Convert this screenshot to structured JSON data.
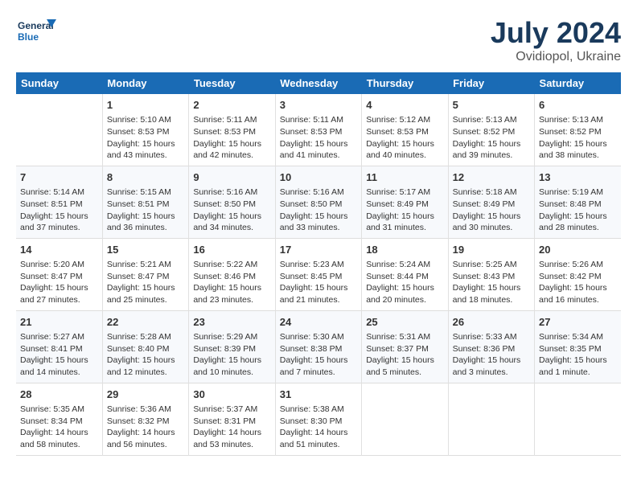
{
  "logo": {
    "line1": "General",
    "line2": "Blue"
  },
  "title": "July 2024",
  "subtitle": "Ovidiopol, Ukraine",
  "headers": [
    "Sunday",
    "Monday",
    "Tuesday",
    "Wednesday",
    "Thursday",
    "Friday",
    "Saturday"
  ],
  "weeks": [
    [
      {
        "day": "",
        "info": ""
      },
      {
        "day": "1",
        "info": "Sunrise: 5:10 AM\nSunset: 8:53 PM\nDaylight: 15 hours\nand 43 minutes."
      },
      {
        "day": "2",
        "info": "Sunrise: 5:11 AM\nSunset: 8:53 PM\nDaylight: 15 hours\nand 42 minutes."
      },
      {
        "day": "3",
        "info": "Sunrise: 5:11 AM\nSunset: 8:53 PM\nDaylight: 15 hours\nand 41 minutes."
      },
      {
        "day": "4",
        "info": "Sunrise: 5:12 AM\nSunset: 8:53 PM\nDaylight: 15 hours\nand 40 minutes."
      },
      {
        "day": "5",
        "info": "Sunrise: 5:13 AM\nSunset: 8:52 PM\nDaylight: 15 hours\nand 39 minutes."
      },
      {
        "day": "6",
        "info": "Sunrise: 5:13 AM\nSunset: 8:52 PM\nDaylight: 15 hours\nand 38 minutes."
      }
    ],
    [
      {
        "day": "7",
        "info": "Sunrise: 5:14 AM\nSunset: 8:51 PM\nDaylight: 15 hours\nand 37 minutes."
      },
      {
        "day": "8",
        "info": "Sunrise: 5:15 AM\nSunset: 8:51 PM\nDaylight: 15 hours\nand 36 minutes."
      },
      {
        "day": "9",
        "info": "Sunrise: 5:16 AM\nSunset: 8:50 PM\nDaylight: 15 hours\nand 34 minutes."
      },
      {
        "day": "10",
        "info": "Sunrise: 5:16 AM\nSunset: 8:50 PM\nDaylight: 15 hours\nand 33 minutes."
      },
      {
        "day": "11",
        "info": "Sunrise: 5:17 AM\nSunset: 8:49 PM\nDaylight: 15 hours\nand 31 minutes."
      },
      {
        "day": "12",
        "info": "Sunrise: 5:18 AM\nSunset: 8:49 PM\nDaylight: 15 hours\nand 30 minutes."
      },
      {
        "day": "13",
        "info": "Sunrise: 5:19 AM\nSunset: 8:48 PM\nDaylight: 15 hours\nand 28 minutes."
      }
    ],
    [
      {
        "day": "14",
        "info": "Sunrise: 5:20 AM\nSunset: 8:47 PM\nDaylight: 15 hours\nand 27 minutes."
      },
      {
        "day": "15",
        "info": "Sunrise: 5:21 AM\nSunset: 8:47 PM\nDaylight: 15 hours\nand 25 minutes."
      },
      {
        "day": "16",
        "info": "Sunrise: 5:22 AM\nSunset: 8:46 PM\nDaylight: 15 hours\nand 23 minutes."
      },
      {
        "day": "17",
        "info": "Sunrise: 5:23 AM\nSunset: 8:45 PM\nDaylight: 15 hours\nand 21 minutes."
      },
      {
        "day": "18",
        "info": "Sunrise: 5:24 AM\nSunset: 8:44 PM\nDaylight: 15 hours\nand 20 minutes."
      },
      {
        "day": "19",
        "info": "Sunrise: 5:25 AM\nSunset: 8:43 PM\nDaylight: 15 hours\nand 18 minutes."
      },
      {
        "day": "20",
        "info": "Sunrise: 5:26 AM\nSunset: 8:42 PM\nDaylight: 15 hours\nand 16 minutes."
      }
    ],
    [
      {
        "day": "21",
        "info": "Sunrise: 5:27 AM\nSunset: 8:41 PM\nDaylight: 15 hours\nand 14 minutes."
      },
      {
        "day": "22",
        "info": "Sunrise: 5:28 AM\nSunset: 8:40 PM\nDaylight: 15 hours\nand 12 minutes."
      },
      {
        "day": "23",
        "info": "Sunrise: 5:29 AM\nSunset: 8:39 PM\nDaylight: 15 hours\nand 10 minutes."
      },
      {
        "day": "24",
        "info": "Sunrise: 5:30 AM\nSunset: 8:38 PM\nDaylight: 15 hours\nand 7 minutes."
      },
      {
        "day": "25",
        "info": "Sunrise: 5:31 AM\nSunset: 8:37 PM\nDaylight: 15 hours\nand 5 minutes."
      },
      {
        "day": "26",
        "info": "Sunrise: 5:33 AM\nSunset: 8:36 PM\nDaylight: 15 hours\nand 3 minutes."
      },
      {
        "day": "27",
        "info": "Sunrise: 5:34 AM\nSunset: 8:35 PM\nDaylight: 15 hours\nand 1 minute."
      }
    ],
    [
      {
        "day": "28",
        "info": "Sunrise: 5:35 AM\nSunset: 8:34 PM\nDaylight: 14 hours\nand 58 minutes."
      },
      {
        "day": "29",
        "info": "Sunrise: 5:36 AM\nSunset: 8:32 PM\nDaylight: 14 hours\nand 56 minutes."
      },
      {
        "day": "30",
        "info": "Sunrise: 5:37 AM\nSunset: 8:31 PM\nDaylight: 14 hours\nand 53 minutes."
      },
      {
        "day": "31",
        "info": "Sunrise: 5:38 AM\nSunset: 8:30 PM\nDaylight: 14 hours\nand 51 minutes."
      },
      {
        "day": "",
        "info": ""
      },
      {
        "day": "",
        "info": ""
      },
      {
        "day": "",
        "info": ""
      }
    ]
  ]
}
